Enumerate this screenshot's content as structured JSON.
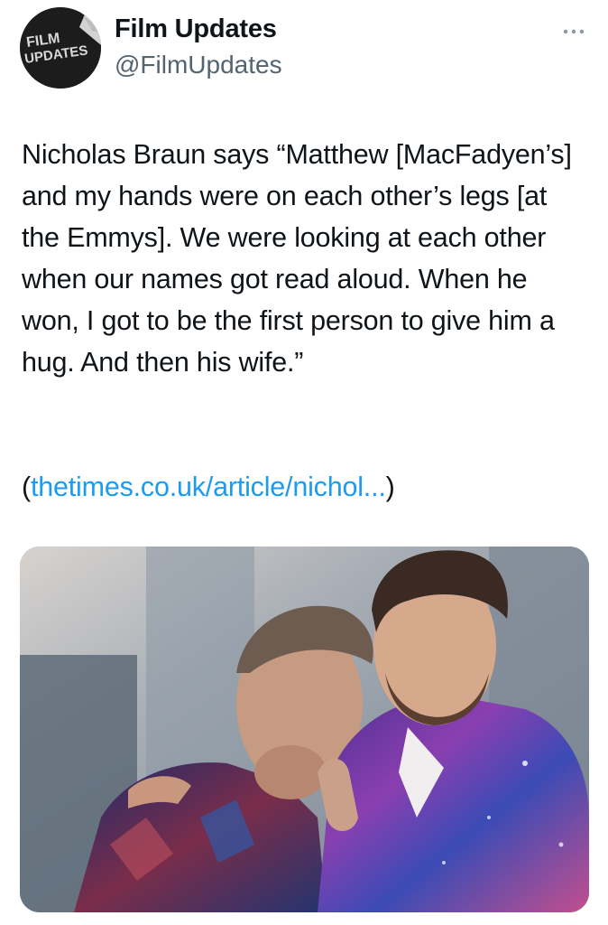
{
  "author": {
    "name": "Film Updates",
    "handle": "@FilmUpdates",
    "avatar_icon": "film-updates-logo",
    "avatar_text_line1": "FILM",
    "avatar_text_line2": "UPDATES"
  },
  "tweet": {
    "text": "Nicholas Braun says “Matthew [MacFadyen’s] and my hands were on each other’s legs [at the Emmys]. We were looking at each other when our names got read aloud. When he won, I got to be the first person to give him a hug. And then his wife.”",
    "link_prefix": "(",
    "link_text": "thetimes.co.uk/article/nichol...",
    "link_suffix": ")"
  },
  "menu": {
    "icon": "more-horizontal-icon"
  },
  "colors": {
    "link": "#1d9bf0",
    "handle": "#536471",
    "text": "#0f1419"
  }
}
